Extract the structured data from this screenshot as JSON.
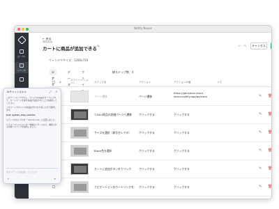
{
  "window": {
    "title": "Notify Nexus"
  },
  "sidebar": {
    "items": [
      {
        "label": "ローカル",
        "icon": "local-icon"
      },
      {
        "label": "シナリオ",
        "icon": "scenario-icon"
      },
      {
        "label": "",
        "icon": "list-icon"
      },
      {
        "label": "",
        "icon": "stack-icon"
      },
      {
        "label": "",
        "icon": "folder-icon"
      }
    ]
  },
  "header": {
    "back_label": "← 戻る",
    "breadcrumb": "商品追加",
    "title": "カートに商品が追加できる",
    "cancel_label": "キャンセル",
    "save_label": "保存"
  },
  "window_size_label": "ウィンドウサイズ：1280x720",
  "tabs": [
    "シナリオ",
    "データ",
    "ファイル"
  ],
  "step_count_label": "総ステップ数：4",
  "table": {
    "headers": [
      "#",
      "スクリーン ショット",
      "ステップ名",
      "アクション",
      "アクションの値",
      "メモ"
    ],
    "rows": [
      {
        "desc": "ページ遷移",
        "action": "ページ遷移",
        "target": "https://gensarov-store-demo.netlify.app/gs/store",
        "thumb": "blank"
      },
      {
        "desc": "T-Shirt商品の詳細ページへ遷移",
        "action": "クリックする",
        "target": "クリックする",
        "thumb": "dark"
      },
      {
        "desc": "サイズを選択（商号セレクタ）",
        "action": "クリックする",
        "target": "クリックする",
        "thumb": "mid"
      },
      {
        "desc": "Black色を選択",
        "action": "クリックする",
        "target": "クリックする",
        "thumb": "mid"
      },
      {
        "desc": "カートに追加ボタンをクリック",
        "action": "クリックする",
        "target": "クリックする",
        "thumb": "dark"
      },
      {
        "desc": "ナビゲーションのカートリンクをク",
        "action": "クリックする",
        "target": "クリックする",
        "thumb": "mid"
      }
    ]
  },
  "chat": {
    "title": "AIチャットスキル",
    "messages": [
      "このページにアクセスし、Tシャツの商品をカートに入れて、カートページを開き商品が追加されたことを確認してください。",
      "このページでTシャツの商品が見つかりましたので選択します。",
      "tool: update_step_selector",
      "ステップのセレクタを「.add-to-cart」に変更しました。",
      "パフォーマンスとユーザー体験のバランスから、推奨される内容でステップを更新しました。"
    ],
    "input_placeholder": "次のステップを記述してください"
  },
  "colors": {
    "accent": "#21b36c",
    "delete": "#e04545",
    "sidebar": "#2e3238"
  }
}
